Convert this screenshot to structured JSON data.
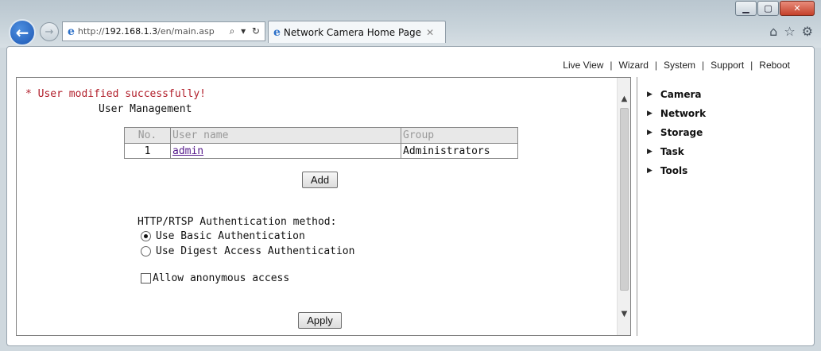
{
  "window": {
    "minimize": "▁",
    "maximize": "▢",
    "close": "✕"
  },
  "browser": {
    "back_icon": "←",
    "forward_icon": "→",
    "address_prefix": "http://",
    "address_host": "192.168.1.3",
    "address_path": "/en/main.asp",
    "address_tools": "⌕ ▾ ↻",
    "tab_title": "Network Camera Home Page",
    "tab_close": "✕",
    "icons": {
      "home": "⌂",
      "favorites": "☆",
      "settings": "⚙"
    }
  },
  "top_nav": {
    "items": [
      "Live View",
      "Wizard",
      "System",
      "Support",
      "Reboot"
    ],
    "separator": "|"
  },
  "main": {
    "success_message": "* User modified successfully!",
    "section_title": "User Management",
    "table": {
      "headers": [
        "No.",
        "User name",
        "Group"
      ],
      "rows": [
        {
          "no": "1",
          "user": "admin",
          "group": "Administrators"
        }
      ]
    },
    "add_label": "Add",
    "auth_label": "HTTP/RTSP Authentication method:",
    "auth_options": [
      "Use Basic Authentication",
      "Use Digest Access Authentication"
    ],
    "auth_selected_index": 0,
    "anonymous_label": "Allow anonymous access",
    "anonymous_checked": false,
    "apply_label": "Apply"
  },
  "side_menu": {
    "items": [
      "Camera",
      "Network",
      "Storage",
      "Task",
      "Tools"
    ]
  }
}
